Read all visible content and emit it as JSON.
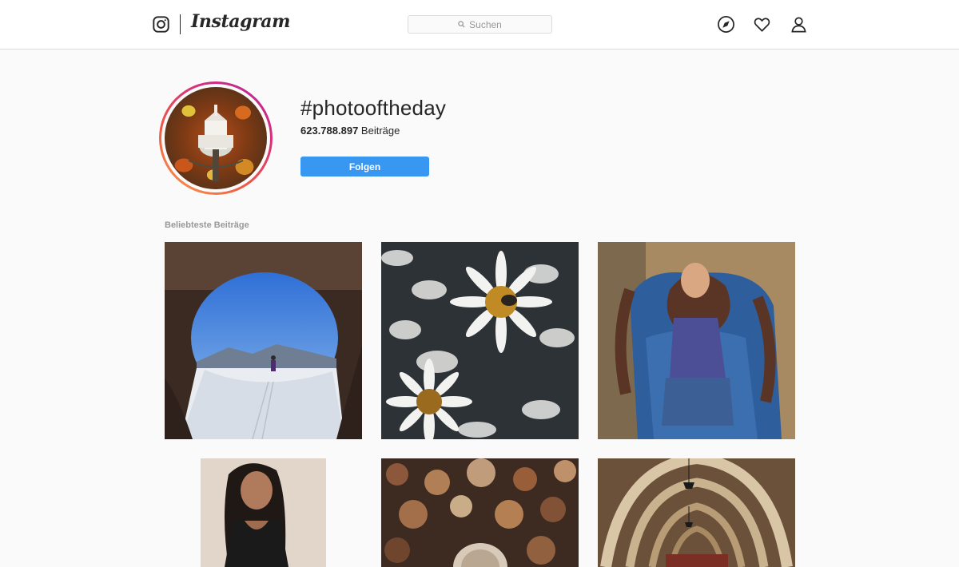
{
  "app": {
    "wordmark": "Instagram"
  },
  "search": {
    "placeholder": "Suchen",
    "icon": "search-icon"
  },
  "nav": {
    "icons": [
      "compass-icon",
      "heart-icon",
      "user-icon"
    ]
  },
  "hashtag": {
    "name": "#photooftheday",
    "post_count": "623.788.897",
    "post_count_label": "Beiträge",
    "follow_label": "Folgen"
  },
  "section": {
    "top_posts_label": "Beliebteste Beiträge"
  },
  "posts": [
    {
      "subject": "snowy cave arch with skier"
    },
    {
      "subject": "daisies with bee"
    },
    {
      "subject": "woman in blue chair"
    },
    {
      "subject": "young woman portrait"
    },
    {
      "subject": "blurred autumn bokeh"
    },
    {
      "subject": "arched corridor with lamps"
    }
  ],
  "colors": {
    "accent": "#3897f0",
    "text": "#262626",
    "muted": "#999999",
    "border": "#dbdbdb",
    "background": "#fafafa"
  }
}
